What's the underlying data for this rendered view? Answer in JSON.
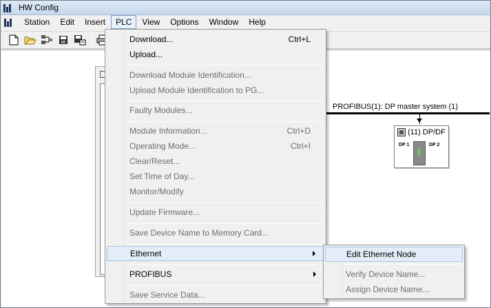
{
  "window": {
    "title": "HW Config"
  },
  "menubar": {
    "items": [
      {
        "label": "Station"
      },
      {
        "label": "Edit"
      },
      {
        "label": "Insert"
      },
      {
        "label": "PLC"
      },
      {
        "label": "View"
      },
      {
        "label": "Options"
      },
      {
        "label": "Window"
      },
      {
        "label": "Help"
      }
    ]
  },
  "toolbar": {
    "buttons": [
      "new-icon",
      "open-icon",
      "network-icon",
      "save-icon",
      "save-compile-icon",
      "print-icon"
    ]
  },
  "network": {
    "bus_label": "PROFIBUS(1): DP master system (1)",
    "device": {
      "title": "(11) DP/DF",
      "port1": "DP 1",
      "port2": "DP 2"
    }
  },
  "plc_menu": {
    "items": [
      {
        "label": "Download...",
        "shortcut": "Ctrl+L",
        "enabled": true
      },
      {
        "label": "Upload...",
        "shortcut": "",
        "enabled": true
      },
      {
        "label": "Download Module Identification...",
        "shortcut": "",
        "enabled": false
      },
      {
        "label": "Upload Module Identification to PG...",
        "shortcut": "",
        "enabled": false
      },
      {
        "label": "Faulty Modules...",
        "shortcut": "",
        "enabled": false
      },
      {
        "label": "Module Information...",
        "shortcut": "Ctrl+D",
        "enabled": false
      },
      {
        "label": "Operating Mode...",
        "shortcut": "Ctrl+I",
        "enabled": false
      },
      {
        "label": "Clear/Reset...",
        "shortcut": "",
        "enabled": false
      },
      {
        "label": "Set Time of Day...",
        "shortcut": "",
        "enabled": false
      },
      {
        "label": "Monitor/Modify",
        "shortcut": "",
        "enabled": false
      },
      {
        "label": "Update Firmware...",
        "shortcut": "",
        "enabled": false
      },
      {
        "label": "Save Device Name to Memory Card...",
        "shortcut": "",
        "enabled": false
      },
      {
        "label": "Ethernet",
        "shortcut": "",
        "enabled": true,
        "submenu": true
      },
      {
        "label": "PROFIBUS",
        "shortcut": "",
        "enabled": true,
        "submenu": true
      },
      {
        "label": "Save Service Data...",
        "shortcut": "",
        "enabled": false
      }
    ]
  },
  "ethernet_submenu": {
    "items": [
      {
        "label": "Edit Ethernet Node",
        "enabled": true
      },
      {
        "label": "Verify Device Name...",
        "enabled": false
      },
      {
        "label": "Assign Device Name...",
        "enabled": false
      }
    ]
  }
}
